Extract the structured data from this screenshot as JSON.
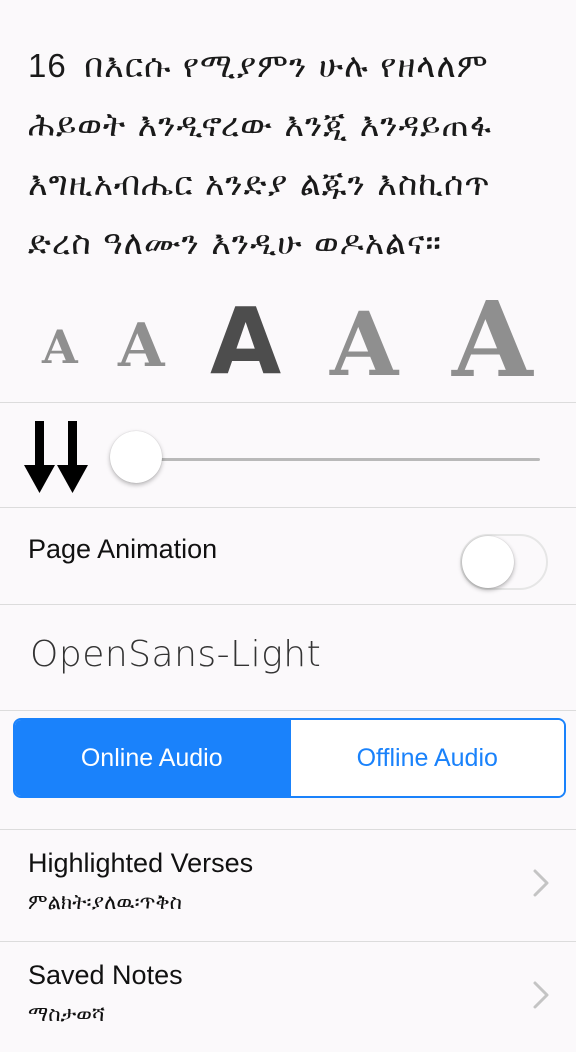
{
  "verse": {
    "number": "16",
    "text": "በእርሱ የሚያምን ሁሉ የዘላለም ሕይወት እንዲኖረው እንጂ እንዳይጠፋ እግዚአብሔር አንድያ ልጁን እስኪሰጥ ድረስ ዓለሙን እንዲሁ ወዶአልና።"
  },
  "font_sizes": {
    "options": [
      "A",
      "A",
      "A",
      "A",
      "A"
    ],
    "selected_index": 2,
    "colors": {
      "normal": "#8f8f8f",
      "selected": "#4d4d4d"
    }
  },
  "speed": {
    "icon": "double-down-arrow-icon",
    "slider_value": 0.0
  },
  "page_animation": {
    "label": "Page Animation",
    "enabled": false
  },
  "font": {
    "name": "OpenSans-Light"
  },
  "audio": {
    "online_label": "Online Audio",
    "offline_label": "Offline Audio",
    "selected": "online",
    "accent_color": "#1a82fb"
  },
  "menu": [
    {
      "title": "Highlighted Verses",
      "subtitle": "ምልክት፡ያለዉ፡ጥቅስ",
      "icon": "chevron-right-icon"
    },
    {
      "title": "Saved Notes",
      "subtitle": "ማስታወሻ",
      "icon": "chevron-right-icon"
    }
  ]
}
